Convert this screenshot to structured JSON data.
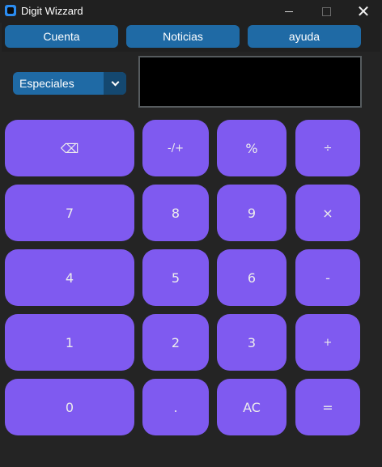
{
  "window": {
    "title": "Digit Wizzard",
    "controls": {
      "minimize": "minimize-icon",
      "maximize": "maximize-icon",
      "close": "✕"
    }
  },
  "menu": {
    "account": "Cuenta",
    "news": "Noticias",
    "help": "ayuda"
  },
  "mode_select": {
    "value": "Especiales"
  },
  "display": {
    "value": ""
  },
  "keys": {
    "backspace": "⌫",
    "sign": "-/+",
    "percent": "%",
    "divide": "÷",
    "seven": "7",
    "eight": "8",
    "nine": "9",
    "multiply": "×",
    "four": "4",
    "five": "5",
    "six": "6",
    "minus": "-",
    "one": "1",
    "two": "2",
    "three": "3",
    "plus": "+",
    "zero": "0",
    "decimal": ".",
    "clear": "AC",
    "equals": "="
  },
  "colors": {
    "key": "#7f5af0",
    "menu_button": "#1f6aa5",
    "dropdown_arrow": "#144870",
    "background": "#242424",
    "display": "#000000"
  }
}
